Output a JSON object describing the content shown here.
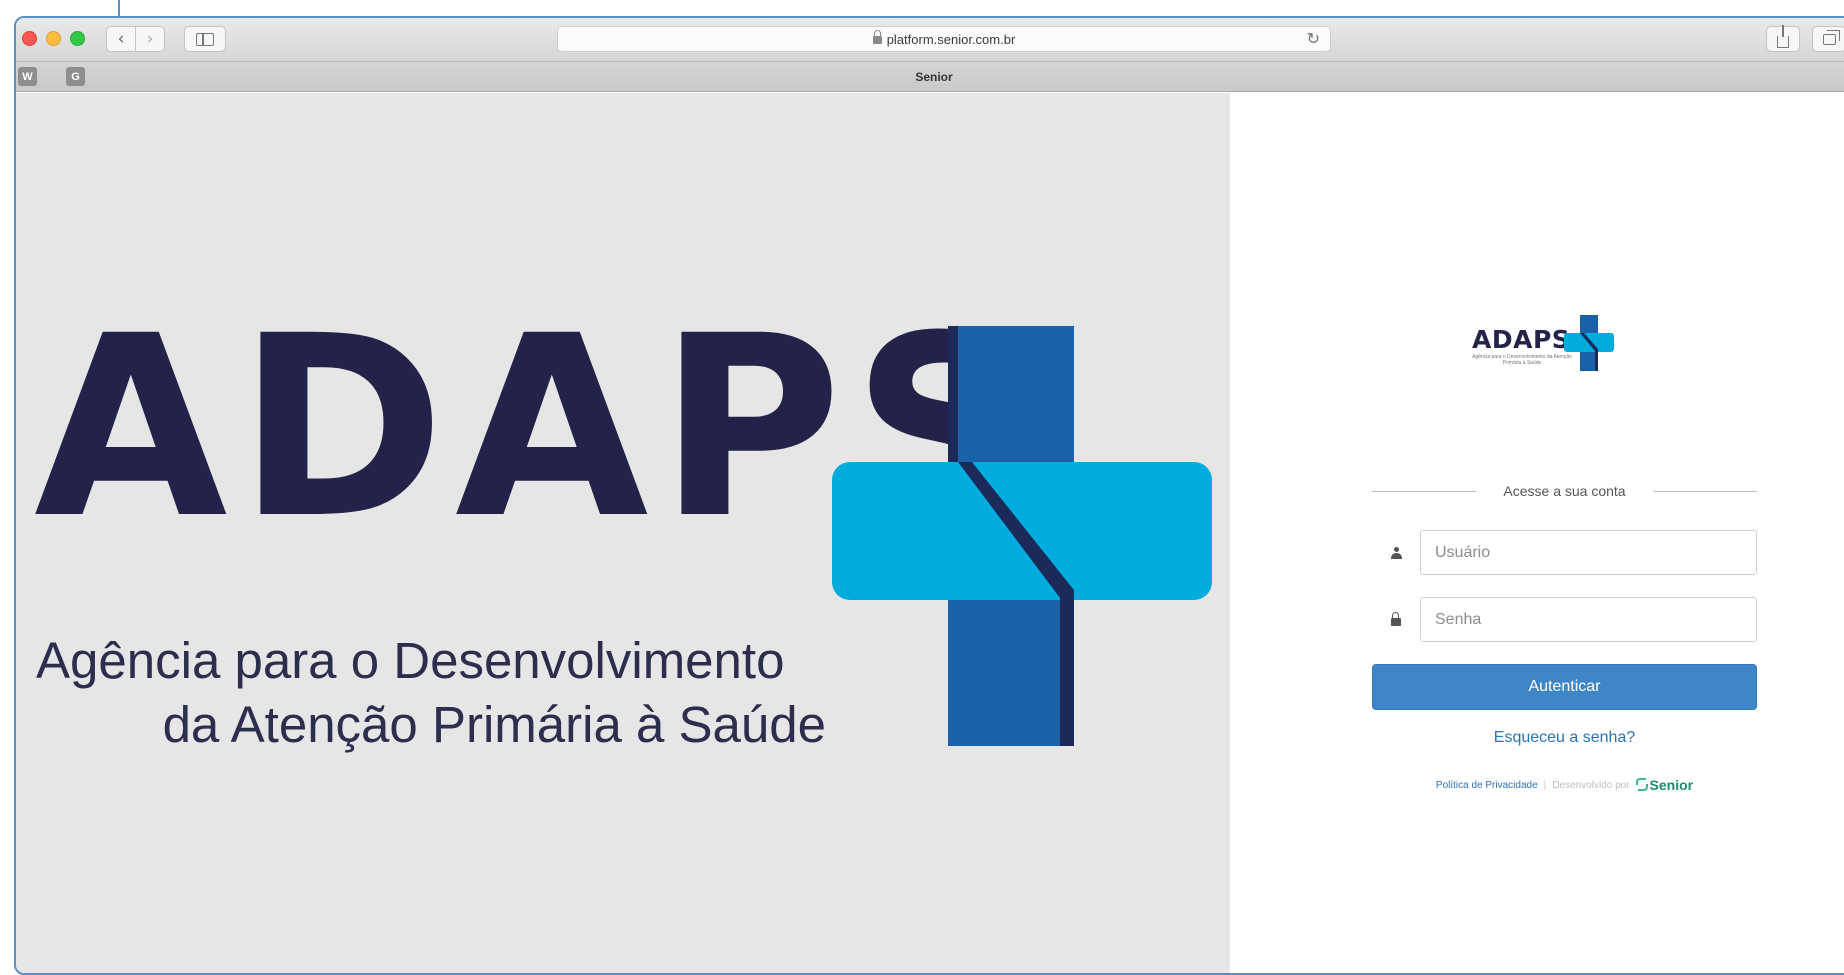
{
  "browser": {
    "url": "platform.senior.com.br",
    "tab_title": "Senior",
    "favorites": [
      "W",
      "G"
    ]
  },
  "hero": {
    "wordmark": "ADAPS",
    "tagline_line1": "Agência para o Desenvolvimento",
    "tagline_line2": "da Atenção Primária à Saúde"
  },
  "login": {
    "logo_word": "ADAPS",
    "logo_subtitle": "Agência para o Desenvolvimento da Atenção Primária à Saúde",
    "heading": "Acesse a sua conta",
    "username_placeholder": "Usuário",
    "password_placeholder": "Senha",
    "submit_label": "Autenticar",
    "forgot_label": "Esqueceu a senha?",
    "privacy_label": "Política de Privacidade",
    "separator": "|",
    "developed_by": "Desenvolvido por",
    "brand": "Senior"
  },
  "colors": {
    "navy": "#23234a",
    "cross_dark": "#1a62a8",
    "cross_light": "#00acde",
    "button": "#3f86c9",
    "link": "#2a72b8",
    "senior_green": "#1d8a6d"
  }
}
